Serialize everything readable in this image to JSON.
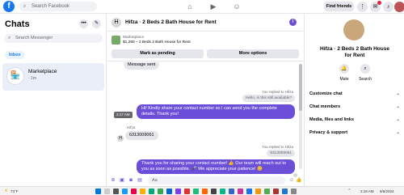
{
  "topbar": {
    "logo": "f",
    "search_placeholder": "Search Facebook",
    "find_friends": "Find friends",
    "nav_icons": [
      "home-icon",
      "video-icon",
      "groups-icon"
    ],
    "menu_icons": [
      "menu-grid-icon",
      "messenger-icon",
      "bell-icon"
    ]
  },
  "sidebar": {
    "title": "Chats",
    "search_placeholder": "Search Messenger",
    "tab": "Inbox",
    "conversation": {
      "title": "Marketplace",
      "subtitle": "· 1m"
    }
  },
  "chat": {
    "title": "Hifza · 2 Beds 2 Bath House for Rent",
    "listing_label": "Marketplace",
    "listing_detail": "$1,250 – 2 Beds 2 Bath House for Rent",
    "mark_pending": "Mark as pending",
    "more_options": "More options",
    "messages": {
      "msg_sent": "Message sent",
      "replied_1": "You replied to Hifza",
      "quoted_1": "Hello, is this still available?",
      "outgoing_1": "Hi! Kindly share your contact number so I can send you the complete details. Thank you!",
      "sender_name": "Hifza",
      "incoming_1": "6313009061",
      "replied_2": "You replied to Hifza",
      "quoted_2": "6313009061",
      "outgoing_2": "Thank you for sharing your contact number! 👍 Our team will reach out to you as soon as possible. 🎤 We appreciate your patience! 😊",
      "hover_tag": "2:17 AM"
    },
    "composer_placeholder": "Aa"
  },
  "details": {
    "name": "Hifza · 2 Beds 2 Bath House for Rent",
    "mute": "Mute",
    "search": "Search",
    "sections": [
      "Customize chat",
      "Chat members",
      "Media, files and links",
      "Privacy & support"
    ]
  },
  "taskbar": {
    "weather": "73°F",
    "time": "2:18 AM",
    "date": "8/6/2024"
  },
  "colors": {
    "accent": "#6b4fd9",
    "brand": "#1877f2"
  }
}
